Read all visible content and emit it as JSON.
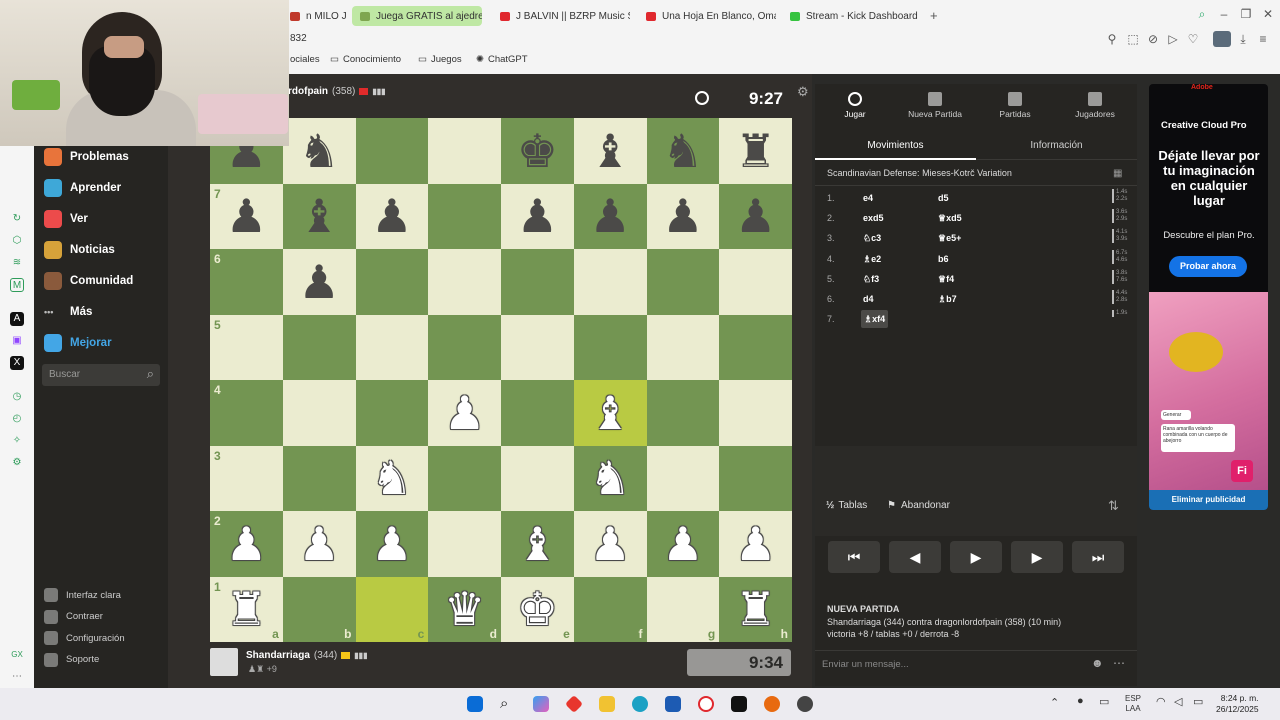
{
  "browser": {
    "tabs": [
      {
        "label": "n MILO J",
        "color": "#c0392b",
        "active": false
      },
      {
        "label": "Juega GRATIS al ajedrez",
        "color": "#7fa650",
        "active": true
      },
      {
        "label": "J BALVIN || BZRP Music S",
        "color": "#e0282e",
        "active": false
      },
      {
        "label": "Una Hoja En Blanco, Oma",
        "color": "#e0282e",
        "active": false
      },
      {
        "label": "Stream - Kick Dashboard",
        "color": "#35c33f",
        "active": false
      }
    ],
    "address_fragment": "832",
    "bookmarks": [
      "ociales",
      "Conocimiento",
      "Juegos",
      "ChatGPT"
    ]
  },
  "sidebar": {
    "items": [
      {
        "label": "Problemas",
        "icon": "puzzle-icon",
        "color": "#e8743b"
      },
      {
        "label": "Aprender",
        "icon": "learn-icon",
        "color": "#3ea8d8"
      },
      {
        "label": "Ver",
        "icon": "watch-icon",
        "color": "#ec4b4b"
      },
      {
        "label": "Noticias",
        "icon": "news-icon",
        "color": "#d6a23a"
      },
      {
        "label": "Comunidad",
        "icon": "community-icon",
        "color": "#8a5a3c"
      },
      {
        "label": "Más",
        "icon": "more-icon",
        "color": "#bbbbbb"
      },
      {
        "label": "Mejorar",
        "icon": "diamond-icon",
        "color": "#43a6e6"
      }
    ],
    "search_placeholder": "Buscar",
    "footer": [
      "Interfaz clara",
      "Contraer",
      "Configuración",
      "Soporte"
    ]
  },
  "game": {
    "top_player": {
      "name": "rdofpain",
      "rating": "(358)",
      "clock": "9:27"
    },
    "bottom_player": {
      "name": "Shandarriaga",
      "rating": "(344)",
      "clock": "9:34",
      "material": "+9"
    },
    "files": [
      "a",
      "b",
      "c",
      "d",
      "e",
      "f",
      "g",
      "h"
    ],
    "ranks_shown": [
      "7",
      "6",
      "5",
      "4",
      "3",
      "2",
      "1"
    ],
    "position": [
      [
        "",
        "bN",
        "",
        "",
        "bK",
        "bB",
        "bN",
        "bR"
      ],
      [
        "bP",
        "bB",
        "bP",
        "",
        "bP",
        "bP",
        "bP",
        "bP"
      ],
      [
        "",
        "bP",
        "",
        "",
        "",
        "",
        "",
        ""
      ],
      [
        "",
        "",
        "",
        "",
        "",
        "",
        "",
        ""
      ],
      [
        "",
        "",
        "",
        "wP",
        "",
        "wB",
        "",
        ""
      ],
      [
        "",
        "",
        "wN",
        "",
        "",
        "wN",
        "",
        ""
      ],
      [
        "wP",
        "wP",
        "wP",
        "",
        "wB",
        "wP",
        "wP",
        "wP"
      ],
      [
        "wR",
        "",
        "",
        "wQ",
        "wK",
        "",
        "",
        "wR"
      ]
    ],
    "first_row_partial_left": "bP",
    "highlight_squares": [
      "c1",
      "f4"
    ],
    "colors": {
      "light": "#ebecd0",
      "dark": "#739552",
      "highlight": "#b9ca43"
    }
  },
  "panel": {
    "tabs": [
      "Jugar",
      "Nueva Partida",
      "Partidas",
      "Jugadores"
    ],
    "subtabs": [
      "Movimientos",
      "Información"
    ],
    "opening": "Scandinavian Defense: Mieses-Kotrč Variation",
    "moves": [
      {
        "n": "1.",
        "w": "e4",
        "b": "d5",
        "t1": "1.4s",
        "t2": "2.2s"
      },
      {
        "n": "2.",
        "w": "exd5",
        "b": "♕xd5",
        "t1": "3.6s",
        "t2": "2.9s"
      },
      {
        "n": "3.",
        "w": "♘c3",
        "b": "♕e5+",
        "t1": "4.1s",
        "t2": "3.9s"
      },
      {
        "n": "4.",
        "w": "♗e2",
        "b": "b6",
        "t1": "6.7s",
        "t2": "4.6s"
      },
      {
        "n": "5.",
        "w": "♘f3",
        "b": "♕f4",
        "t1": "3.8s",
        "t2": "7.6s"
      },
      {
        "n": "6.",
        "w": "d4",
        "b": "♗b7",
        "t1": "4.4s",
        "t2": "2.8s"
      },
      {
        "n": "7.",
        "w": "♗xf4",
        "b": "",
        "t1": "1.9s",
        "t2": ""
      }
    ],
    "controls": [
      "⏮",
      "◀",
      "▶",
      "▶",
      "⏭"
    ],
    "draw_label": "Tablas",
    "draw_prefix": "½",
    "resign_label": "Abandonar",
    "new_game_title": "NUEVA PARTIDA",
    "new_game_line": "Shandarriaga (344) contra dragonlordofpain (358) (10 min)",
    "new_game_result": "victoria +8 / tablas +0 / derrota -8",
    "chat_placeholder": "Enviar un mensaje..."
  },
  "ad": {
    "brand": "Adobe",
    "product": "Creative Cloud Pro",
    "headline": "Déjate llevar por tu imaginación en cualquier lugar",
    "sub": "Descubre el plan Pro.",
    "cta": "Probar ahora",
    "bubble1": "Generar",
    "bubble2": "Rana amarilla volando combinada con un cuerpo de abejorro",
    "badge": "Fi",
    "remove": "Eliminar publicidad"
  },
  "taskbar": {
    "lang": "ESP",
    "lang2": "LAA",
    "time": "8:24 p. m.",
    "date": "26/12/2025"
  }
}
